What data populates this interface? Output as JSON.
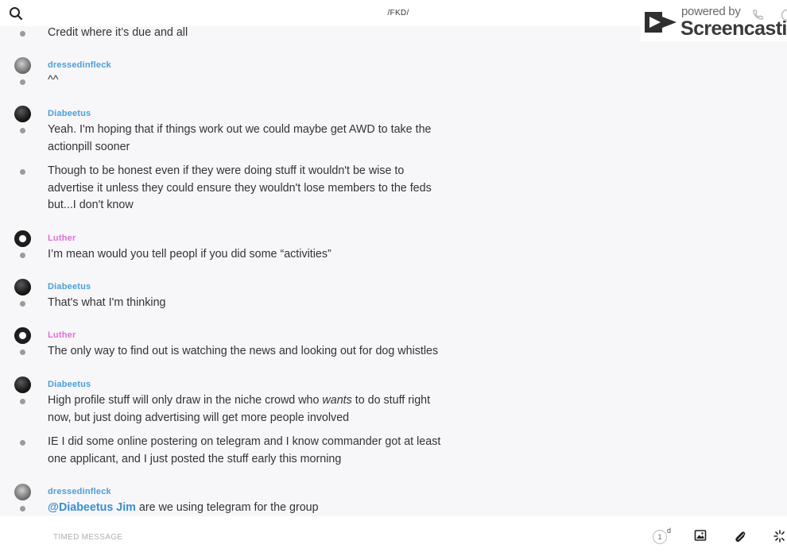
{
  "header": {
    "title": "/FKD/",
    "search_icon": "search-icon"
  },
  "watermark": {
    "powered": "powered by",
    "brand": "Screencastify"
  },
  "messages": [
    {
      "author": null,
      "text": "Credit where it’s due and all"
    },
    {
      "author": "dressedinfleck",
      "author_color": "#4a9fd6",
      "avatar": "grey",
      "text": "^^"
    },
    {
      "author": "Diabeetus",
      "author_color": "#4a9fd6",
      "avatar": "dark",
      "text": "Yeah. I'm hoping that if things work out we could maybe get AWD to take the actionpill sooner"
    },
    {
      "author": null,
      "text": "Though to be honest even if they were doing stuff it wouldn't be wise to advertise it unless they could ensure they wouldn't lose members to the feds but...I don't know"
    },
    {
      "author": "Luther",
      "author_color": "#e06fd4",
      "avatar": "badge",
      "text": "I’m mean would you tell peopl if you did some “activities”"
    },
    {
      "author": "Diabeetus",
      "author_color": "#4a9fd6",
      "avatar": "dark",
      "text": "That's what I'm thinking"
    },
    {
      "author": "Luther",
      "author_color": "#e06fd4",
      "avatar": "badge",
      "text": "The only way to find out is watching the news and looking out for dog whistles"
    },
    {
      "author": "Diabeetus",
      "author_color": "#4a9fd6",
      "avatar": "dark",
      "text_before": "High profile stuff will only draw in the niche crowd who ",
      "text_em": "wants",
      "text_after": " to do stuff right now, but just doing advertising will get more people involved"
    },
    {
      "author": null,
      "text": "IE I did some online postering on telegram and I know commander got at least one applicant, and I just posted the stuff early this morning"
    },
    {
      "author": "dressedinfleck",
      "author_color": "#4a9fd6",
      "avatar": "grey",
      "mention": "@Diabeetus Jim",
      "text": " are we using telegram for the group"
    }
  ],
  "composer": {
    "placeholder": "TIMED MESSAGE",
    "timer_value": "1",
    "timer_unit": "d"
  },
  "icons": {
    "image": "image-icon",
    "attach": "paperclip-icon",
    "more": "sparkle-icon"
  }
}
